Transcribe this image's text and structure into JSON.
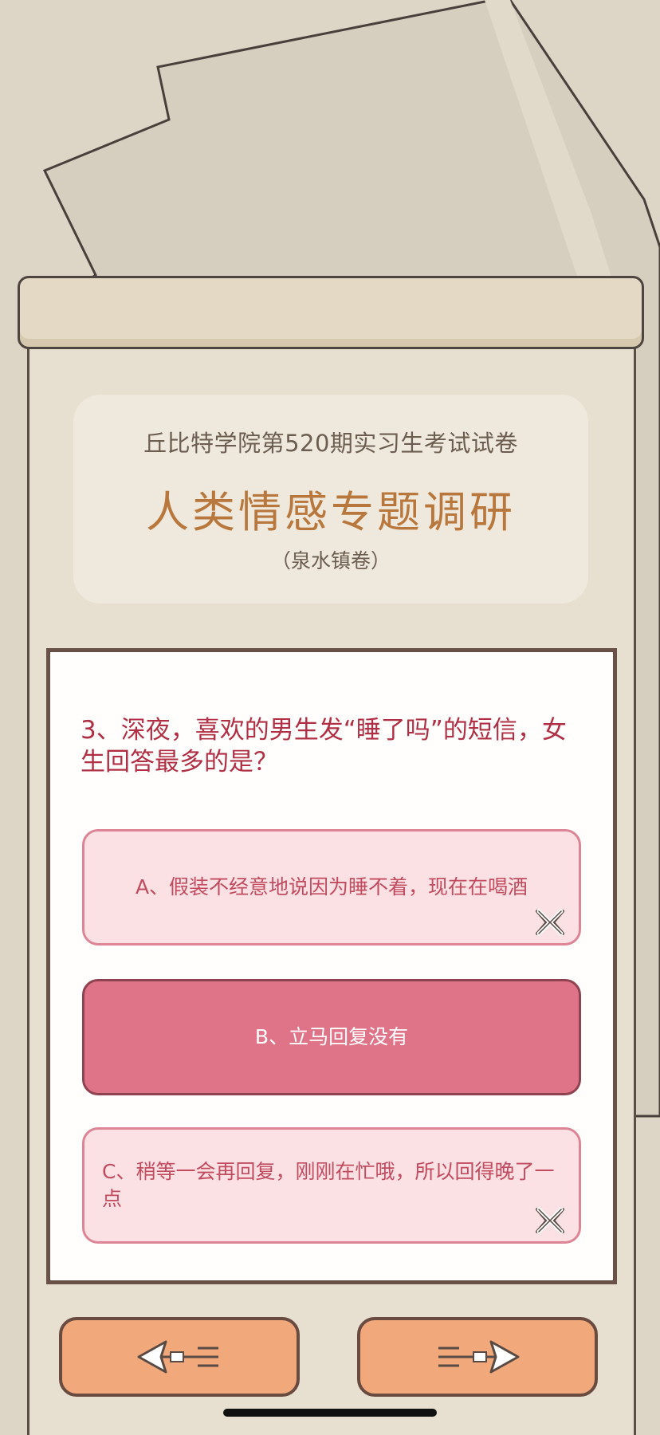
{
  "header": {
    "subtitle": "丘比特学院第520期实习生考试试卷",
    "title": "人类情感专题调研",
    "volume": "（泉水镇卷）"
  },
  "question": {
    "text": "3、深夜，喜欢的男生发“睡了吗”的短信，女生回答最多的是？"
  },
  "options": [
    {
      "label": "A、假装不经意地说因为睡不着，现在在喝酒",
      "state": "wrong"
    },
    {
      "label": "B、立马回复没有",
      "state": "selected"
    },
    {
      "label": "C、稍等一会再回复，刚刚在忙哦，所以回得晚了一点",
      "state": "wrong"
    }
  ],
  "navigation": {
    "prev_icon": "left-arrow-icon",
    "next_icon": "right-arrow-icon"
  },
  "colors": {
    "title": "#b8783d",
    "question": "#b02f45",
    "option_bg": "#fbe0e4",
    "option_selected_bg": "#df7388",
    "nav_button": "#f1a97c"
  }
}
